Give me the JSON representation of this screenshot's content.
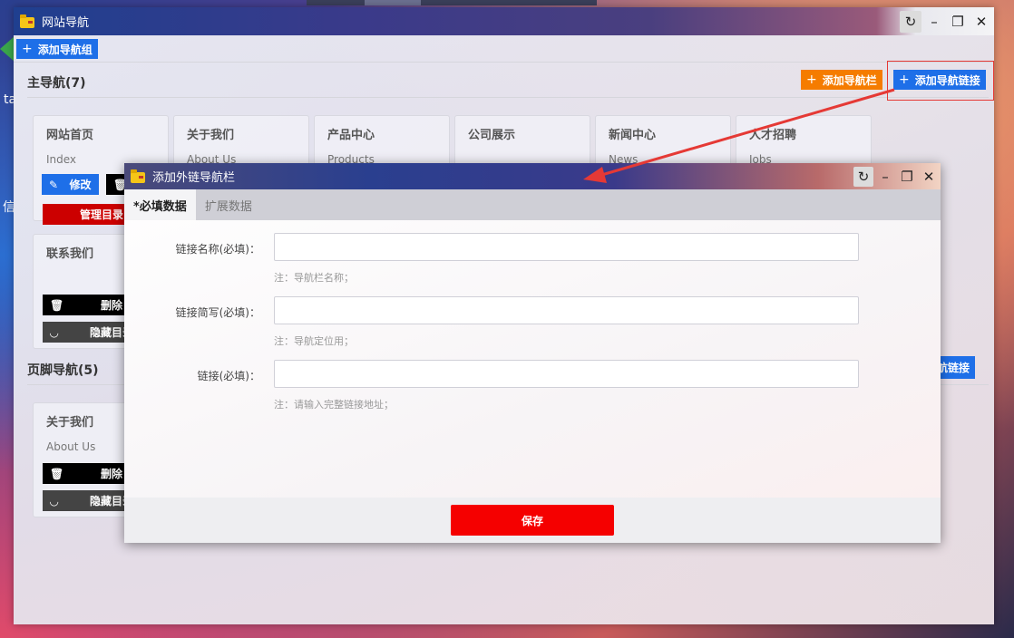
{
  "desktop": {
    "frag1": "ta",
    "frag2": "信"
  },
  "main_window": {
    "title": "网站导航",
    "toolbar": {
      "add_group": "添加导航组"
    },
    "main_nav": {
      "title": "主导航(7)",
      "add_bar": "添加导航栏",
      "add_link": "添加导航链接",
      "cards": [
        {
          "title": "网站首页",
          "sub": "Index",
          "edit": "修改",
          "manage": "管理目录"
        },
        {
          "title": "关于我们",
          "sub": "About Us"
        },
        {
          "title": "产品中心",
          "sub": "Products"
        },
        {
          "title": "公司展示",
          "sub": ""
        },
        {
          "title": "新闻中心",
          "sub": "News"
        },
        {
          "title": "人才招聘",
          "sub": "Jobs"
        },
        {
          "title": "联系我们",
          "sub": "",
          "delete": "删除",
          "hide": "隐藏目录"
        }
      ]
    },
    "footer_nav": {
      "title": "页脚导航(5)",
      "add_link_partial": "导航链接",
      "cards": [
        {
          "title": "关于我们",
          "sub": "About Us",
          "delete": "删除",
          "hide": "隐藏目录"
        }
      ]
    }
  },
  "dialog": {
    "title": "添加外链导航栏",
    "tabs": [
      "*必填数据",
      "扩展数据"
    ],
    "fields": [
      {
        "label": "链接名称(必填)：",
        "value": "",
        "note": "注：导航栏名称；"
      },
      {
        "label": "链接简写(必填)：",
        "value": "",
        "note": "注：导航定位用；"
      },
      {
        "label": "链接(必填)：",
        "value": "",
        "note": "注：请输入完整链接地址；"
      }
    ],
    "save": "保存"
  },
  "colors": {
    "blue": "#1e6fe8",
    "orange": "#f57c00",
    "red": "#f50000",
    "dark_red": "#cc0000",
    "annotation": "#e53935"
  }
}
